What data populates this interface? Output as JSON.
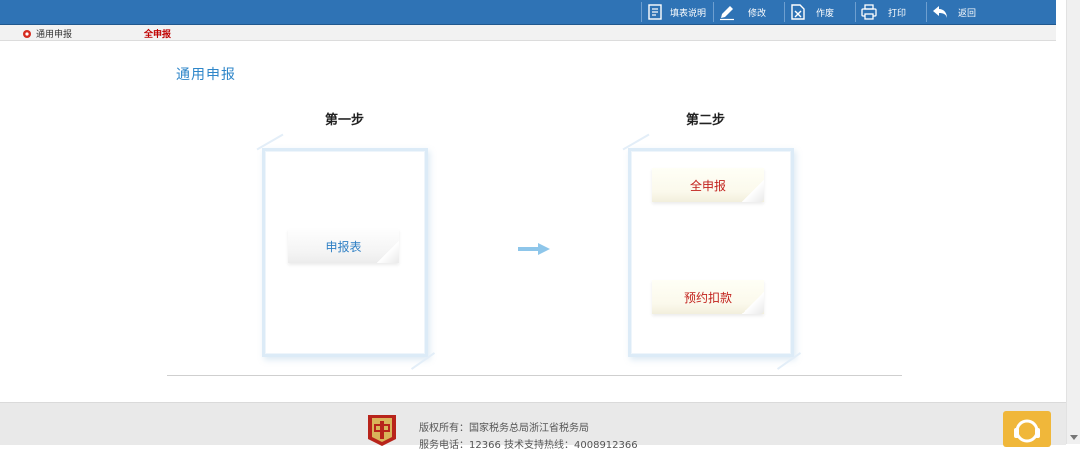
{
  "toolbar": {
    "fill_instructions": "填表说明",
    "modify": "修改",
    "void": "作废",
    "print": "打印",
    "back": "返回"
  },
  "breadcrumb": {
    "home": "通用申报",
    "active": "全申报"
  },
  "page": {
    "title": "通用申报",
    "step1_label": "第一步",
    "step2_label": "第二步",
    "step1_button": "申报表",
    "step2_button_full": "全申报",
    "step2_button_reserve": "预约扣款"
  },
  "footer": {
    "copyright": "版权所有：国家税务总局浙江省税务局",
    "service": "服务电话：12366 技术支持热线：4008912366"
  },
  "colors": {
    "topbar": "#2f73b5",
    "title": "#2e86c9",
    "active_crumb": "#c00000",
    "arrow": "#8ec6ea"
  }
}
